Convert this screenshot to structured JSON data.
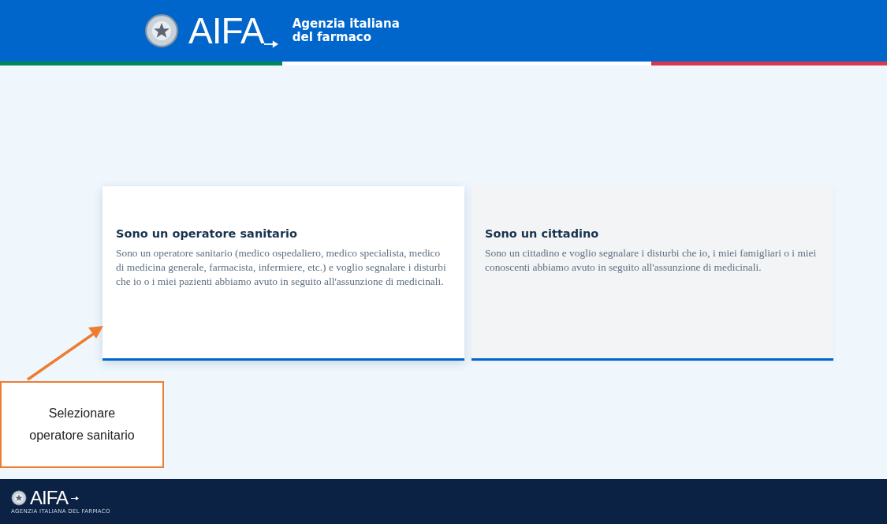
{
  "header": {
    "logo": "AIFA",
    "title": "Agenzia italiana del farmaco"
  },
  "cards": [
    {
      "title": "Sono un operatore sanitario",
      "text": "Sono un operatore sanitario (medico ospedaliero, medico specialista, medico di medicina generale, farmacista, infermiere, etc.) e voglio segnalare i disturbi che io o i miei pazienti abbiamo avuto in seguito all'assunzione di medicinali.",
      "selected": true
    },
    {
      "title": "Sono un cittadino",
      "text": "Sono un cittadino e voglio segnalare i disturbi che io, i miei famigliari o i miei conoscenti abbiamo avuto in seguito all'assunzione di medicinali.",
      "selected": false
    }
  ],
  "callout": {
    "lines": [
      "Selezionare",
      "operatore sanitario"
    ]
  },
  "footer": {
    "logo": "AIFA",
    "caption": "AGENZIA ITALIANA DEL FARMACO"
  }
}
